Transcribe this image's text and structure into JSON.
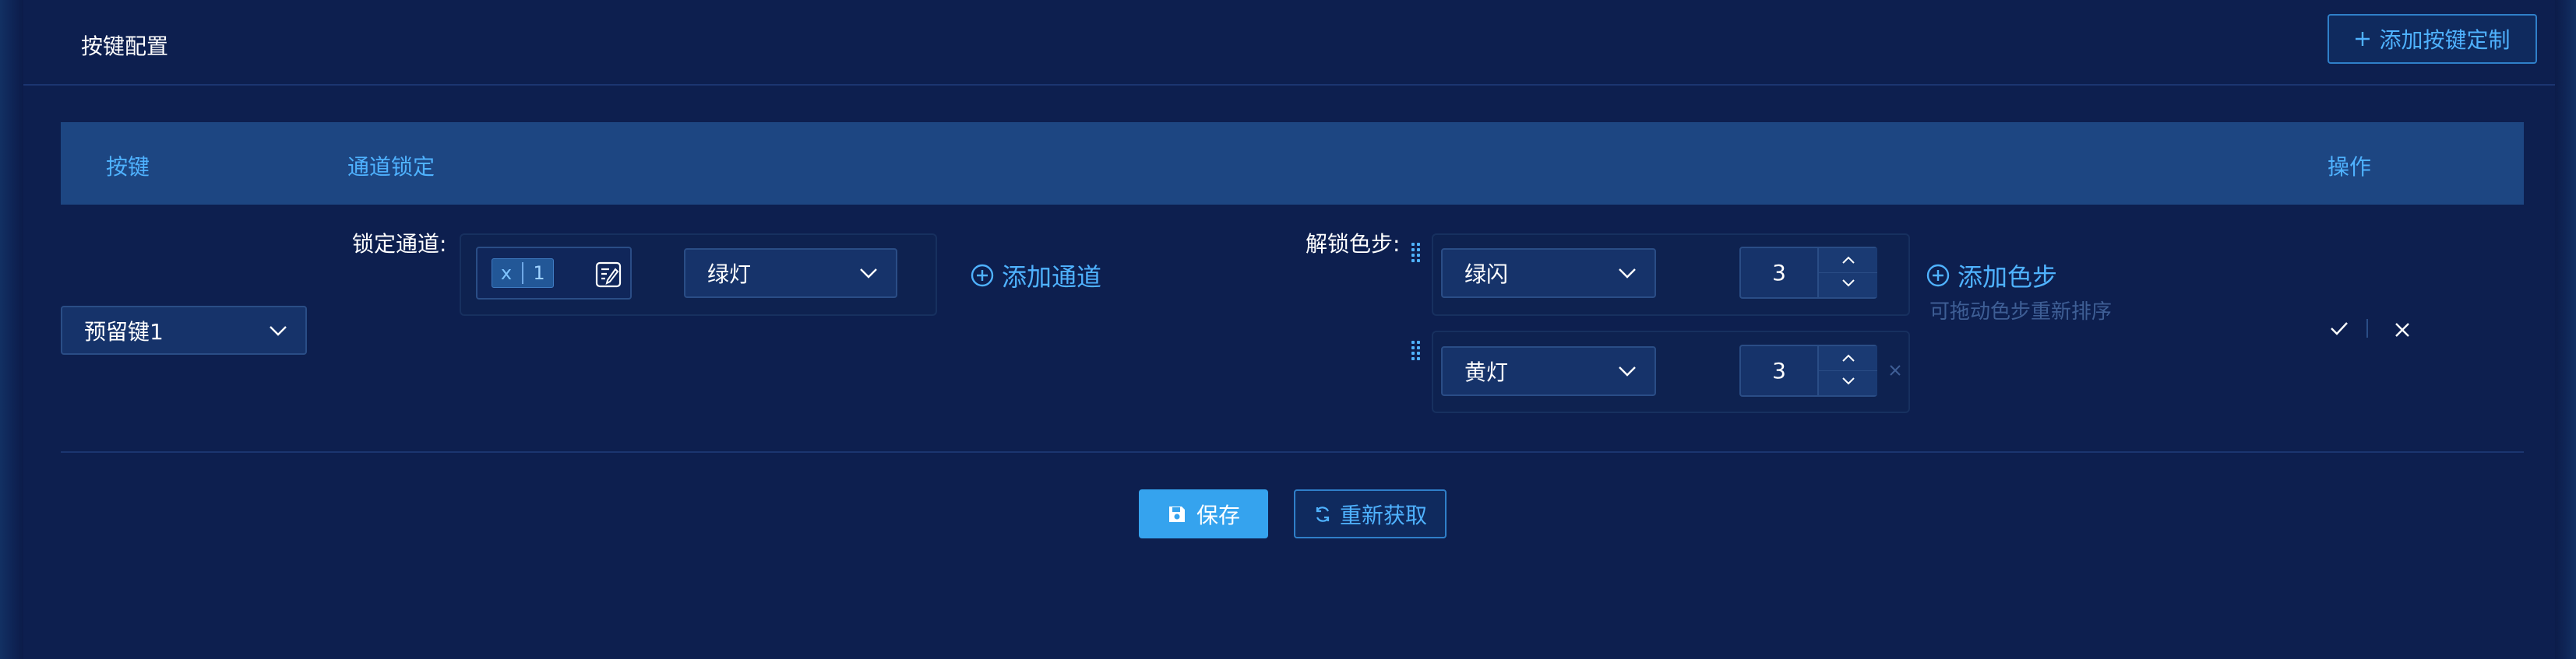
{
  "header": {
    "title": "按键配置",
    "add_button": "添加按键定制"
  },
  "table": {
    "columns": {
      "key": "按键",
      "channel_lock": "通道锁定",
      "actions": "操作"
    }
  },
  "row": {
    "key_select": "预留键1",
    "lock_label": "锁定通道:",
    "lock_tag": {
      "remove": "x",
      "value": "1"
    },
    "light_select": "绿灯",
    "add_channel": "添加通道",
    "unlock_label": "解锁色步:",
    "steps": [
      {
        "color": "绿闪",
        "value": "3"
      },
      {
        "color": "黄灯",
        "value": "3"
      }
    ],
    "add_step": "添加色步",
    "drag_hint": "可拖动色步重新排序"
  },
  "footer": {
    "save": "保存",
    "refetch": "重新获取"
  },
  "colors": {
    "accent": "#4fb2ff",
    "primary_button": "#35a3ee",
    "background": "#0d1f4f",
    "table_header": "#1d4682"
  }
}
